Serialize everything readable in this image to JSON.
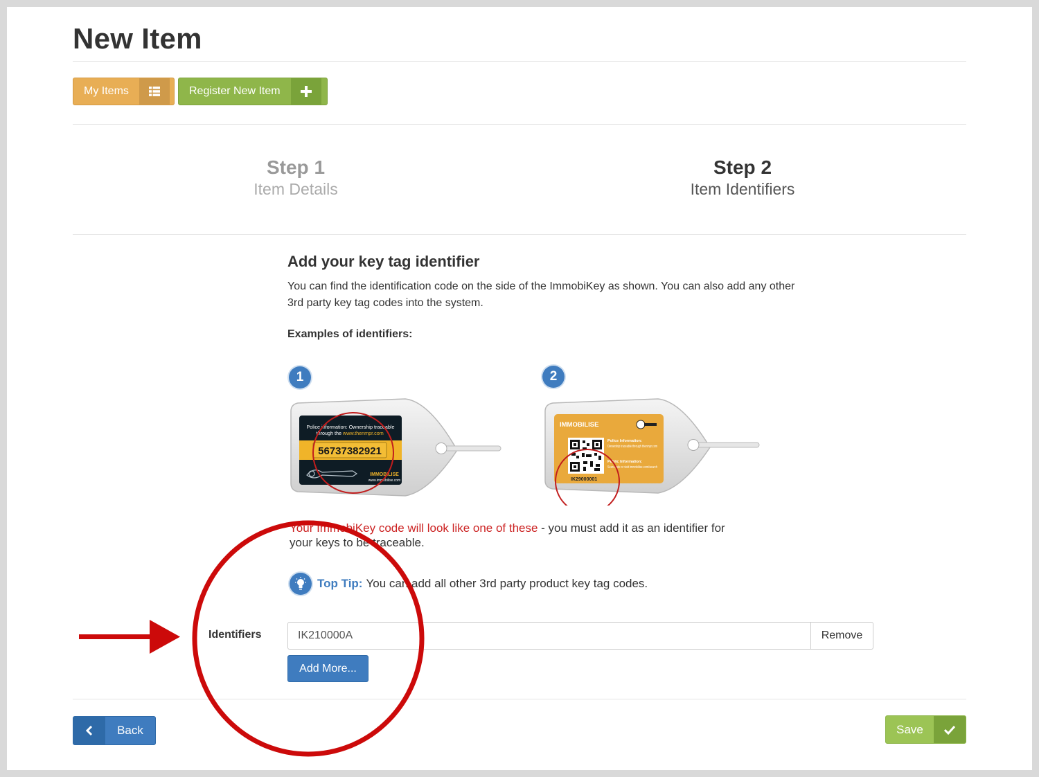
{
  "page": {
    "title": "New Item"
  },
  "toolbar": {
    "my_items_label": "My Items",
    "register_label": "Register New Item",
    "colors": {
      "orange": "#e8ae55",
      "green": "#8fb64a"
    }
  },
  "steps": [
    {
      "title": "Step 1",
      "subtitle": "Item Details",
      "state": "inactive"
    },
    {
      "title": "Step 2",
      "subtitle": "Item Identifiers",
      "state": "active"
    }
  ],
  "section": {
    "title": "Add your key tag identifier",
    "description": "You can find the identification code on the side of the ImmobiKey as shown. You can also add any other 3rd party key tag codes into the system.",
    "examples_heading": "Examples of identifiers:"
  },
  "examples": [
    {
      "number": "1",
      "tag_text_line1": "Police information: Ownership traceable",
      "tag_text_line2": "through the",
      "tag_text_link": "www.thenmpr.com",
      "code": "56737382921",
      "brand": "IMMOBILISE",
      "url": "www.immobilise.com"
    },
    {
      "number": "2",
      "brand": "IMMOBILISE",
      "police_heading": "Police Information:",
      "police_text": "Ownership traceable through thenmpr.com",
      "public_heading": "Public Information:",
      "public_text": "Scan code or visit immobilise.com/search",
      "code": "IK29000001"
    }
  ],
  "note": {
    "red_text": "Your ImmobiKey code will look like one of these",
    "rest_text": " - you must add it as an identifier for your keys to be traceable."
  },
  "tip": {
    "label": "Top Tip:",
    "text": "You can add all other 3rd party product key tag codes."
  },
  "identifiers": {
    "label": "Identifiers",
    "value": "IK210000A",
    "remove_label": "Remove",
    "add_more_label": "Add More..."
  },
  "footer": {
    "back_label": "Back",
    "save_label": "Save"
  },
  "annotation": {
    "color": "#cc0a0a"
  }
}
